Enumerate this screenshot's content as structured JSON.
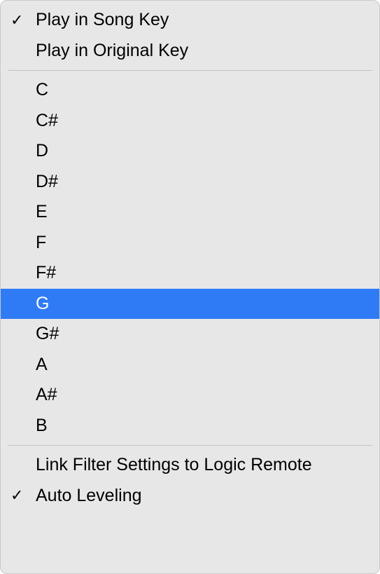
{
  "menu": {
    "sections": [
      {
        "items": [
          {
            "id": "play-song-key",
            "label": "Play in Song Key",
            "checked": true,
            "highlighted": false
          },
          {
            "id": "play-original-key",
            "label": "Play in Original Key",
            "checked": false,
            "highlighted": false
          }
        ]
      },
      {
        "items": [
          {
            "id": "key-c",
            "label": "C",
            "checked": false,
            "highlighted": false
          },
          {
            "id": "key-c-sharp",
            "label": "C#",
            "checked": false,
            "highlighted": false
          },
          {
            "id": "key-d",
            "label": "D",
            "checked": false,
            "highlighted": false
          },
          {
            "id": "key-d-sharp",
            "label": "D#",
            "checked": false,
            "highlighted": false
          },
          {
            "id": "key-e",
            "label": "E",
            "checked": false,
            "highlighted": false
          },
          {
            "id": "key-f",
            "label": "F",
            "checked": false,
            "highlighted": false
          },
          {
            "id": "key-f-sharp",
            "label": "F#",
            "checked": false,
            "highlighted": false
          },
          {
            "id": "key-g",
            "label": "G",
            "checked": false,
            "highlighted": true
          },
          {
            "id": "key-g-sharp",
            "label": "G#",
            "checked": false,
            "highlighted": false
          },
          {
            "id": "key-a",
            "label": "A",
            "checked": false,
            "highlighted": false
          },
          {
            "id": "key-a-sharp",
            "label": "A#",
            "checked": false,
            "highlighted": false
          },
          {
            "id": "key-b",
            "label": "B",
            "checked": false,
            "highlighted": false
          }
        ]
      },
      {
        "items": [
          {
            "id": "link-filter-settings",
            "label": "Link Filter Settings to Logic Remote",
            "checked": false,
            "highlighted": false
          },
          {
            "id": "auto-leveling",
            "label": "Auto Leveling",
            "checked": true,
            "highlighted": false
          }
        ]
      }
    ]
  },
  "glyphs": {
    "checkmark": "✓"
  }
}
